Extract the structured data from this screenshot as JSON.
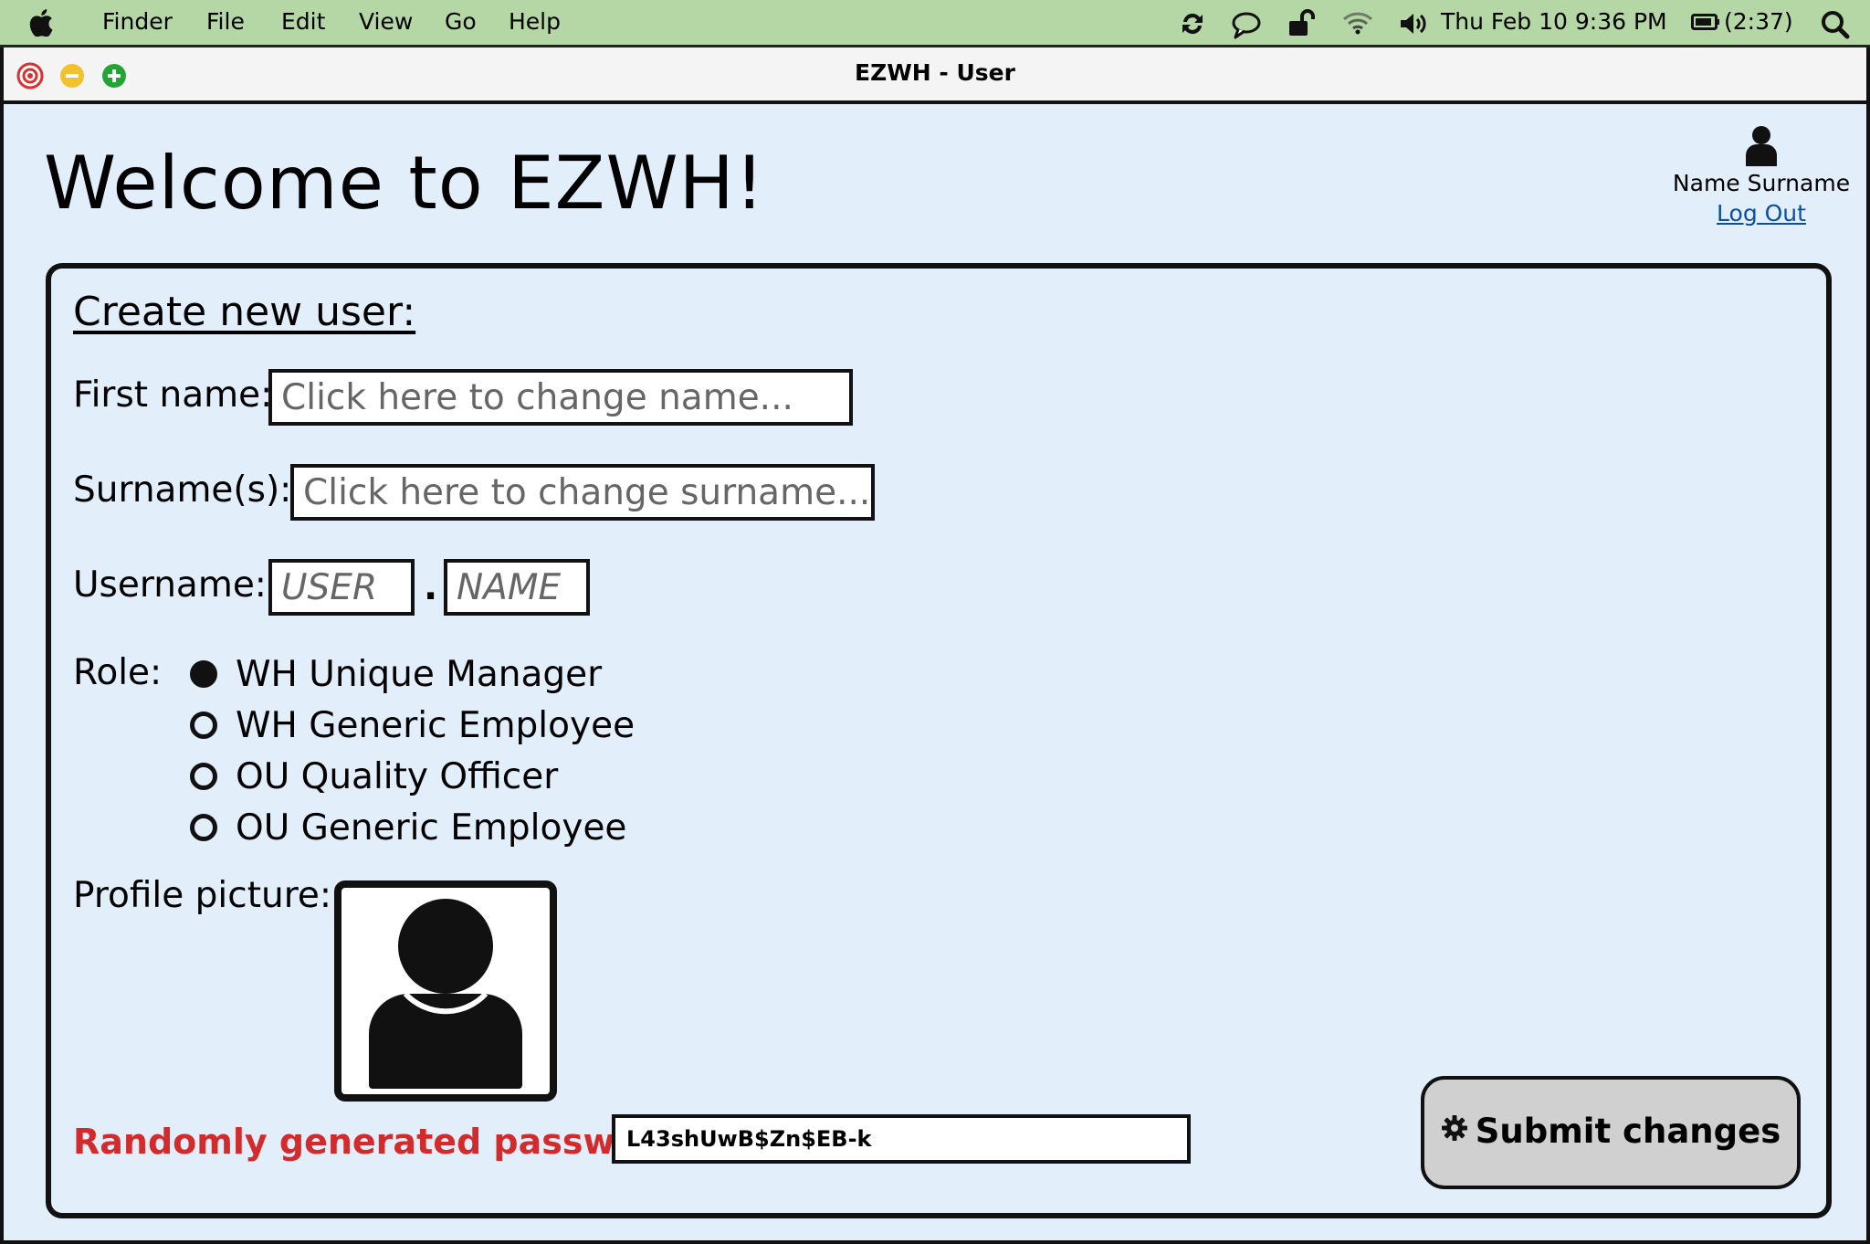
{
  "menubar": {
    "items": [
      "Finder",
      "File",
      "Edit",
      "View",
      "Go",
      "Help"
    ],
    "clock": "Thu Feb 10  9:36 PM",
    "battery": "(2:37)",
    "background": "#b5d6a5"
  },
  "window": {
    "title": "EZWH - User"
  },
  "header": {
    "welcome": "Welcome to EZWH!",
    "user_name": "Name Surname",
    "logout": "Log Out"
  },
  "form": {
    "heading": "Create new user:",
    "first_name": {
      "label": "First name:",
      "placeholder": "Click here to change name..."
    },
    "surname": {
      "label": "Surname(s):",
      "placeholder": "Click here to change surname..."
    },
    "username": {
      "label": "Username:",
      "user_placeholder": "USER",
      "separator": ".",
      "name_placeholder": "NAME"
    },
    "role": {
      "label": "Role:",
      "options": [
        {
          "label": "WH Unique Manager",
          "selected": true
        },
        {
          "label": "WH Generic Employee",
          "selected": false
        },
        {
          "label": "OU Quality Officer",
          "selected": false
        },
        {
          "label": "OU Generic Employee",
          "selected": false
        }
      ]
    },
    "profile_picture_label": "Profile picture:",
    "password": {
      "label": "Randomly generated password:",
      "value": "L43shUwB$Zn$EB-k",
      "label_color": "#d32b2b"
    },
    "submit": "Submit changes"
  },
  "icons": {
    "apple": "apple-icon",
    "sync": "sync-icon",
    "chat": "chat-bubble-icon",
    "lock": "unlocked-padlock-icon",
    "wifi": "wifi-icon",
    "volume": "speaker-icon",
    "battery": "battery-icon",
    "search": "search-icon",
    "user": "user-icon",
    "gear": "gear-icon"
  },
  "colors": {
    "window_bg": "#e2eefa",
    "link": "#0b4fa0",
    "close": "#d9312f",
    "minimize": "#f2c12e",
    "zoom": "#22a535"
  }
}
